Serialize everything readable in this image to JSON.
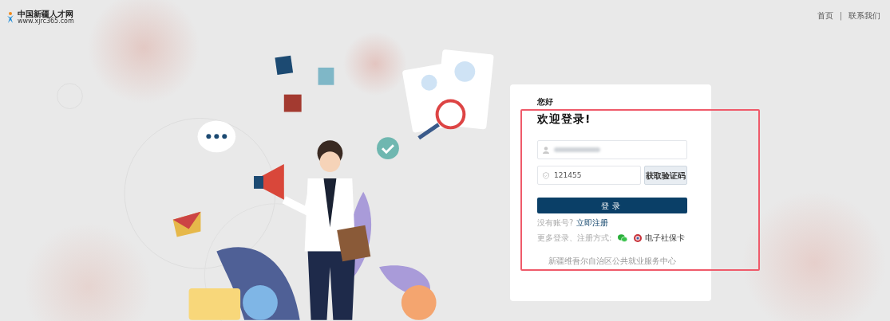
{
  "logo": {
    "title": "中国新疆人才网",
    "url": "www.xjrc365.com"
  },
  "nav_links": [
    {
      "label": "首页"
    },
    {
      "label": "联系我们"
    }
  ],
  "nav_separator": "|",
  "login": {
    "greeting": "您好",
    "title": "欢迎登录!",
    "username_field": {
      "blurred": true
    },
    "code_field": {
      "value": "121455"
    },
    "code_button": "获取验证码",
    "submit": "登录",
    "register_prompt": "没有账号?",
    "register_link": "立即注册",
    "alt_label": "更多登录、注册方式:",
    "alt_methods": [
      {
        "kind": "wechat"
      },
      {
        "kind": "ecard",
        "label": "电子社保卡"
      }
    ],
    "footer": "新疆维吾尔自治区公共就业服务中心"
  },
  "highlight_frame": {
    "shown": true
  }
}
